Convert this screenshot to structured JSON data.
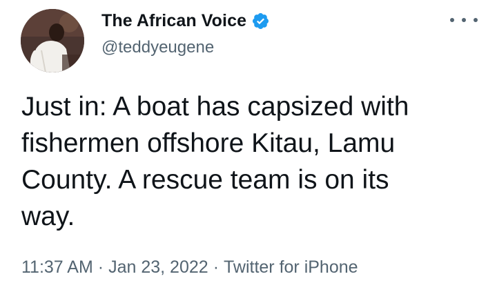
{
  "account": {
    "display_name": "The African Voice",
    "handle": "@teddyeugene",
    "verified_icon": "verified-badge-icon",
    "verified_color": "#1d9bf0",
    "avatar_icon": "profile-avatar"
  },
  "menu": {
    "icon": "more-options-icon"
  },
  "tweet": {
    "text": "Just in: A boat has capsized with\nfishermen offshore Kitau, Lamu\nCounty. A rescue team is on its\nway."
  },
  "meta": {
    "time": "11:37 AM",
    "separator": "·",
    "date": "Jan 23, 2022",
    "source": "Twitter for iPhone"
  },
  "colors": {
    "text": "#0f1419",
    "secondary": "#536471",
    "accent": "#1d9bf0"
  }
}
